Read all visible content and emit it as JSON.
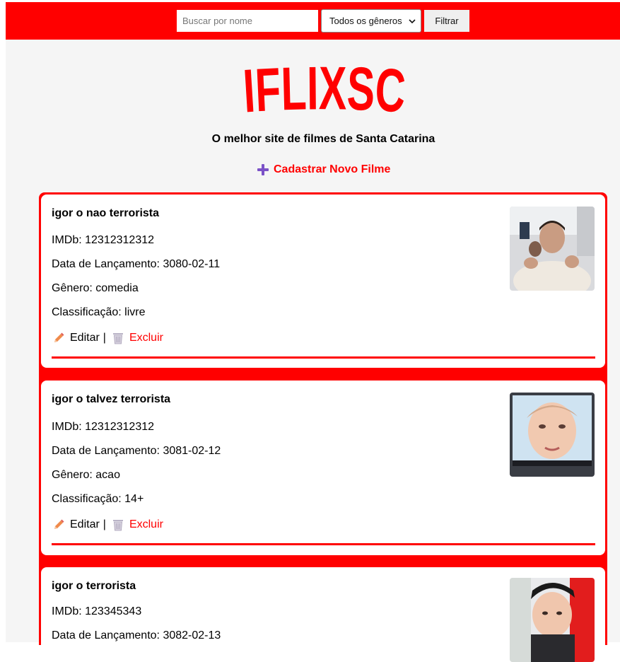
{
  "search": {
    "placeholder": "Buscar por nome",
    "value": ""
  },
  "genre_filter": {
    "selected": "Todos os gêneros"
  },
  "filter_button": {
    "label": "Filtrar"
  },
  "brand": {
    "logo_text": "IFLIXSC",
    "color": "#ff0000"
  },
  "tagline": "O melhor site de filmes de Santa Catarina",
  "add_movie": {
    "label": "Cadastrar Novo Filme"
  },
  "labels": {
    "imdb": "IMDb: ",
    "release": "Data de Lançamento: ",
    "genre": "Gênero: ",
    "rating": "Classificação: ",
    "edit": "Editar",
    "separator": "|",
    "delete": "Excluir"
  },
  "movies": [
    {
      "title": "igor o nao terrorista",
      "imdb": "12312312312",
      "release": "3080-02-11",
      "genre": "comedia",
      "rating": "livre"
    },
    {
      "title": "igor o talvez terrorista",
      "imdb": "12312312312",
      "release": "3081-02-12",
      "genre": "acao",
      "rating": "14+"
    },
    {
      "title": "igor o terrorista",
      "imdb": "123345343",
      "release": "3082-02-13"
    }
  ]
}
